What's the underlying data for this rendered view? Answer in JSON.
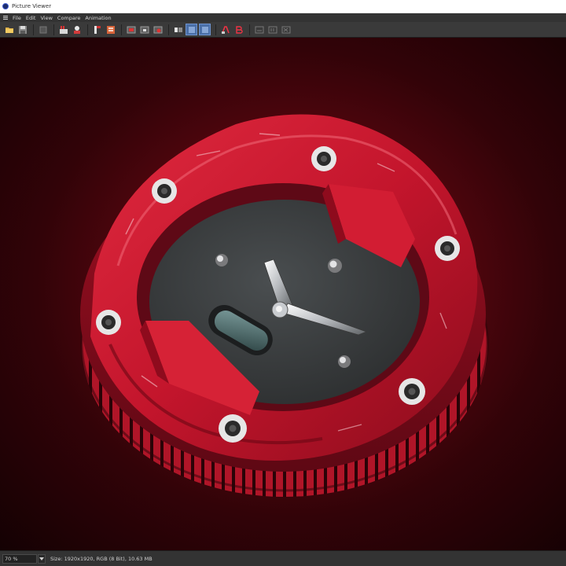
{
  "window": {
    "title": "Picture Viewer"
  },
  "menu": {
    "items": [
      {
        "id": "file",
        "label": "File"
      },
      {
        "id": "edit",
        "label": "Edit"
      },
      {
        "id": "view",
        "label": "View"
      },
      {
        "id": "compare",
        "label": "Compare"
      },
      {
        "id": "animation",
        "label": "Animation"
      }
    ]
  },
  "toolbar": {
    "icons": [
      "open-folder-icon",
      "save-icon",
      "render-icon",
      "render-settings-icon",
      "render-region-icon",
      "crop-icon",
      "filter-icon",
      "layer-icon",
      "fit-icon",
      "fullscreen-icon",
      "channel-icon",
      "compare-a-icon",
      "compare-b-icon",
      "split-icon",
      "ab-swap-icon",
      "history-icon"
    ]
  },
  "colors": {
    "accent": "#4a6fa8",
    "background_red": "#5b0710",
    "clock_body": "#c3152c",
    "clock_face": "#3a3d3e"
  },
  "status": {
    "zoom": "70 %",
    "info": "Size: 1920x1920, RGB (8 Bit), 10.63 MB"
  }
}
